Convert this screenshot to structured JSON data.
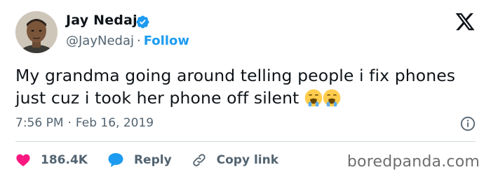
{
  "author": {
    "name": "Jay Nedaj",
    "handle": "@JayNedaj",
    "separator": "·",
    "follow_label": "Follow",
    "verified": true
  },
  "tweet": {
    "text": "My grandma going around telling people i fix phones just cuz i took her phone off silent",
    "emojis": [
      "loudly-crying-face",
      "loudly-crying-face"
    ],
    "time": "7:56 PM",
    "date_separator": "·",
    "date": "Feb 16, 2019"
  },
  "actions": {
    "likes": "186.4K",
    "reply_label": "Reply",
    "copy_link_label": "Copy link"
  },
  "watermark": "boredpanda.com",
  "colors": {
    "accent": "#1d9bf0",
    "like": "#f91880",
    "secondary_text": "#536471",
    "divider": "#cfd9de"
  }
}
